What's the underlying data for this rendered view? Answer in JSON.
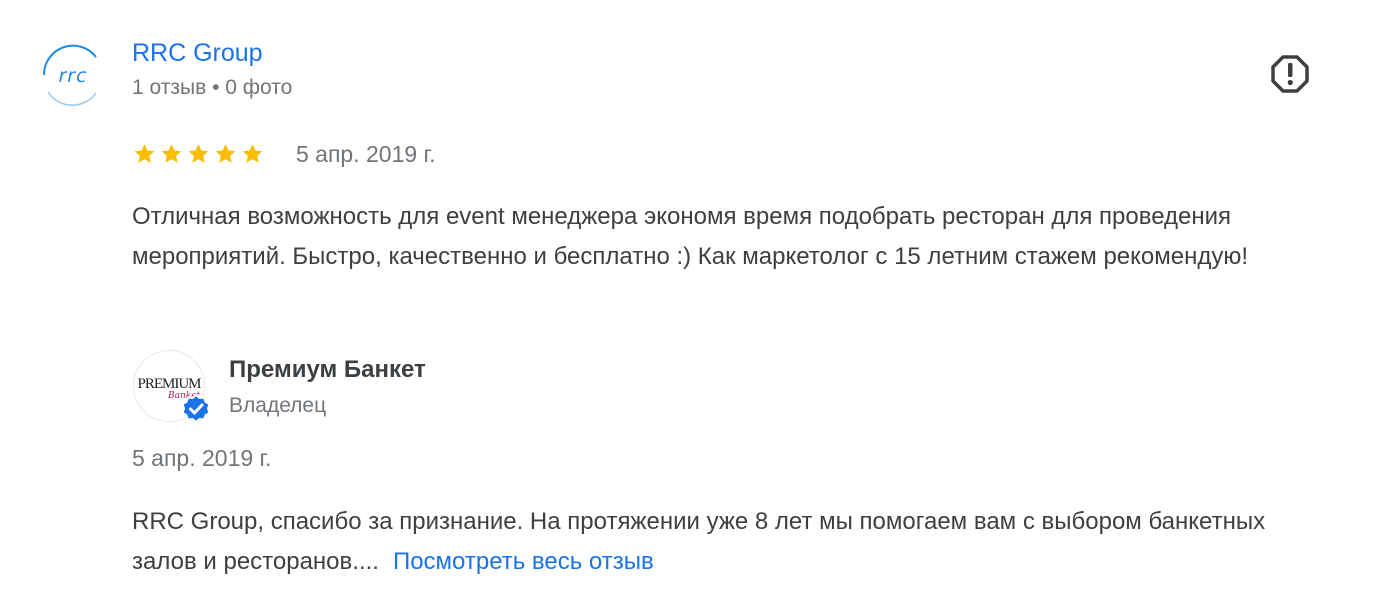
{
  "review": {
    "author": {
      "name": "RRC Group",
      "meta": "1 отзыв • 0 фото",
      "avatar_logo_text": "rrc",
      "avatar_color": "#1e88e5"
    },
    "rating": 5,
    "rating_max": 5,
    "date": "5 апр. 2019 г.",
    "text": "Отличная возможность для event менеджера экономя время подобрать ресторан для проведения мероприятий. Быстро, качественно и бесплатно :) Как маркетолог с 15 летним стажем рекомендую!",
    "report_icon": "report-flag-icon"
  },
  "owner_reply": {
    "name": "Премиум Банкет",
    "role": "Владелец",
    "avatar_text": "PREMIUM",
    "avatar_script": "Banket",
    "verified": true,
    "date": "5 апр. 2019 г.",
    "text": "RRC Group, спасибо за признание. На протяжении уже 8 лет мы помогаем вам с выбором банкетных залов и ресторанов....",
    "read_more": "Посмотреть весь отзыв"
  },
  "colors": {
    "link": "#1a73e8",
    "star": "#fbbc04",
    "text": "#3c4043",
    "secondary": "#70757a",
    "verified": "#1a73e8"
  }
}
